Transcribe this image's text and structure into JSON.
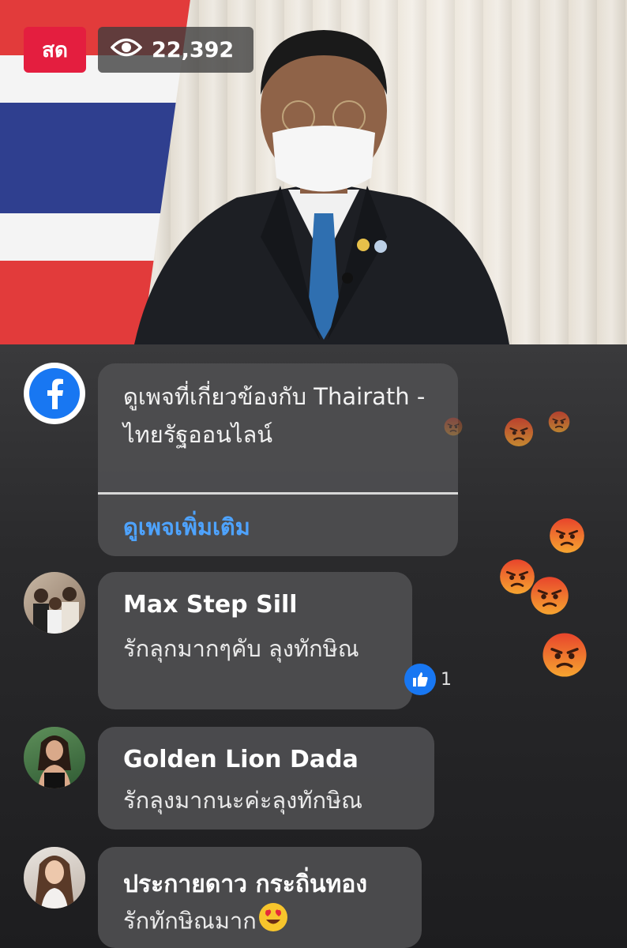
{
  "live": {
    "badge": "สด",
    "viewer_count": "22,392",
    "viewer_icon": "eye-icon"
  },
  "page_promo": {
    "text": "ดูเพจที่เกี่ยวข้องกับ Thairath - ไทยรัฐออนไลน์",
    "link": "ดูเพจเพิ่มเติม",
    "icon": "facebook-icon"
  },
  "comments": [
    {
      "name": "Max Step Sill",
      "text": "รักลุกมากๆคับ  ลุงทักษิณ",
      "reaction_count": "1",
      "reaction_icon": "like-icon"
    },
    {
      "name": "Golden Lion Dada",
      "text": "รักลุงมากนะค่ะลุงทักษิณ"
    },
    {
      "name": "ประกายดาว กระถิ่นทอง",
      "text": "รักทักษิณมาก",
      "emoji": "heart-eyes-emoji"
    }
  ],
  "floating_reactions": [
    "angry-emoji",
    "angry-emoji",
    "angry-emoji",
    "angry-emoji",
    "angry-emoji",
    "angry-emoji",
    "angry-emoji"
  ],
  "colors": {
    "live_red": "#e41e3f",
    "link_blue": "#4ea3ff",
    "facebook_blue": "#1877f2",
    "angry_orange": "#f0642a"
  }
}
